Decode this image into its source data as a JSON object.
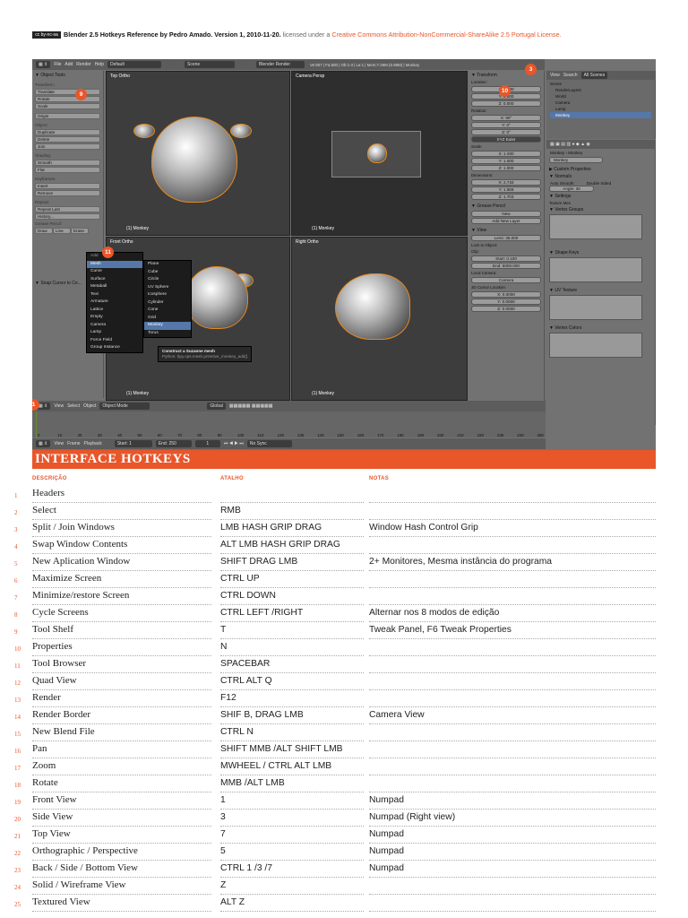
{
  "header": {
    "cc_badge": "cc by-nc-sa",
    "title": "Blender 2.5 Hotkeys Reference by Pedro Amado. Version 1, 2010-11-20.",
    "license_text": " licensed under a ",
    "license_link": "Creative Commons Attribution-NonCommercial-ShareAlike 2.5 Portugal License."
  },
  "screenshot": {
    "top_bar": {
      "menus": [
        "File",
        "Add",
        "Render",
        "Help"
      ],
      "layout": "Default",
      "scene": "Scene",
      "engine": "Blender Render",
      "stats": "Ve:507 | Fa:500 | Ob:1-3 | La:1 | Mem:7.29M (5.98M) | Monkey"
    },
    "tool_shelf": {
      "title": "▼ Object Tools",
      "sections": [
        {
          "label": "Transform:",
          "buttons": [
            "Translate",
            "Rotate",
            "Scale"
          ]
        },
        {
          "label": "",
          "buttons": [
            "Origin"
          ]
        },
        {
          "label": "Object:",
          "buttons": [
            "Duplicate",
            "Delete",
            "Join"
          ]
        },
        {
          "label": "Shading:",
          "buttons": [
            "Smooth",
            "Flat"
          ]
        },
        {
          "label": "Keyframes:",
          "buttons": [
            "Insert",
            "Remove"
          ]
        },
        {
          "label": "Repeat:",
          "buttons": [
            "Repeat Last",
            "History..."
          ]
        },
        {
          "label": "Grease Pencil:",
          "buttons": [
            "Draw",
            "Line",
            "Erase"
          ]
        }
      ],
      "snap_label": "▼ Snap Cursor to Ce..."
    },
    "views": [
      {
        "label": "Top Ortho",
        "footer": "(1) Monkey"
      },
      {
        "label": "Camera Persp",
        "footer": "(1) Monkey"
      },
      {
        "label": "Front Ortho",
        "footer": "(1) Monkey"
      },
      {
        "label": "Right Ortho",
        "footer": "(1) Monkey"
      }
    ],
    "add_menu": {
      "title": "Add",
      "items": [
        "Mesh",
        "Curve",
        "Surface",
        "Metaball",
        "Text",
        "Armature",
        "Lattice",
        "Empty",
        "Camera",
        "Lamp",
        "Force Field",
        "Group Instance"
      ],
      "mesh_items": [
        "Plane",
        "Cube",
        "Circle",
        "UV Sphere",
        "Icosphere",
        "Cylinder",
        "Cone",
        "Grid",
        "Monkey",
        "Torus"
      ],
      "tooltip": "Construct a Suzanne mesh",
      "tooltip_python": "Python: bpy.ops.mesh.primitive_monkey_add()"
    },
    "properties_panel": {
      "transform_title": "▼ Transform",
      "location_label": "Location:",
      "location": [
        "X: 0.000",
        "Y: 0.000",
        "Z: 0.000"
      ],
      "rotation_label": "Rotation:",
      "rotation": [
        "X: 90°",
        "Y: 0°",
        "Z: 0°"
      ],
      "rotation_mode": "XYZ Euler",
      "scale_label": "Scale:",
      "scale": [
        "X: 1.000",
        "Y: 1.000",
        "Z: 1.000"
      ],
      "dimensions_label": "Dimensions:",
      "dimensions": [
        "X: 2.734",
        "Y: 1.969",
        "Z: 1.703"
      ],
      "grease_title": "▼ Grease Pencil",
      "grease_new": "New",
      "grease_add": "Add New Layer",
      "view_title": "▼ View",
      "lens": "Lens: 35.000",
      "lock_label": "Lock to Object:",
      "clip_label": "Clip:",
      "clip": [
        "Start: 0.100",
        "End: 5000.000"
      ],
      "local_camera": "Local Camera:",
      "camera_field": "Camera",
      "cursor_label": "3D Cursor Location:",
      "cursor": [
        "X: 0.0000",
        "Y: 0.0000",
        "Z: 0.0000"
      ]
    },
    "outliner": {
      "header_view": "View",
      "header_search": "Search",
      "header_scope": "All Scenes",
      "items": [
        "Scene",
        "RenderLayers",
        "World",
        "Camera",
        "Lamp",
        "Monkey"
      ]
    },
    "object_props": {
      "breadcrumb": "Monkey",
      "breadcrumb2": "Monkey",
      "name": "Monkey",
      "sections": [
        "▶ Custom Properties",
        "▼ Normals",
        "▼ Settings",
        "▼ Vertex Groups",
        "▼ Shape Keys",
        "▼ UV Texture",
        "▼ Vertex Colors"
      ],
      "auto_smooth": "Auto Smooth",
      "double_sided": "Double Sided",
      "angle": "Angle: 30",
      "texture_mesh": "Texture Mes"
    },
    "view3d_header": {
      "items": [
        "View",
        "Select",
        "Object"
      ],
      "mode": "Object Mode",
      "orientation": "Global"
    },
    "timeline": {
      "ticks": [
        "0",
        "10",
        "20",
        "30",
        "40",
        "50",
        "60",
        "70",
        "80",
        "90",
        "100",
        "110",
        "120",
        "130",
        "140",
        "150",
        "160",
        "170",
        "180",
        "190",
        "200",
        "210",
        "220",
        "230",
        "240",
        "250"
      ],
      "menus": [
        "View",
        "Frame",
        "Playback"
      ],
      "start": "Start: 1",
      "end": "End: 250",
      "current": "1",
      "sync": "No Sync"
    },
    "badges": [
      "1",
      "3",
      "9",
      "10",
      "11"
    ]
  },
  "section_title": "INTERFACE HOTKEYS",
  "columns": {
    "desc": "DESCRIÇÃO",
    "shortcut": "ATALHO",
    "notes": "NOTAS"
  },
  "rows": [
    {
      "n": "1",
      "desc": "Headers",
      "key": "",
      "note": ""
    },
    {
      "n": "2",
      "desc": "Select",
      "key": "RMB",
      "note": ""
    },
    {
      "n": "3",
      "desc": "Split / Join Windows",
      "key": "LMB HASH GRIP DRAG",
      "note": "Window Hash Control Grip"
    },
    {
      "n": "4",
      "desc": "Swap Window Contents",
      "key": "ALT  LMB HASH GRIP DRAG",
      "note": ""
    },
    {
      "n": "5",
      "desc": "New Aplication Window",
      "key": "SHIFT DRAG LMB",
      "note": "2+ Monitores, Mesma instância do programa"
    },
    {
      "n": "6",
      "desc": "Maximize Screen",
      "key": "CTRL UP",
      "note": ""
    },
    {
      "n": "7",
      "desc": "Minimize/restore Screen",
      "key": "CTRL DOWN",
      "note": ""
    },
    {
      "n": "8",
      "desc": "Cycle Screens",
      "key": "CTRL LEFT /RIGHT",
      "note": "Alternar nos 8 modos de edição"
    },
    {
      "n": "9",
      "desc": "Tool Shelf",
      "key": "T",
      "note": "Tweak Panel, F6 Tweak Properties"
    },
    {
      "n": "10",
      "desc": "Properties",
      "key": "N",
      "note": ""
    },
    {
      "n": "11",
      "desc": "Tool Browser",
      "key": "SPACEBAR",
      "note": ""
    },
    {
      "n": "12",
      "desc": "Quad View",
      "key": "CTRL ALT Q",
      "note": ""
    },
    {
      "n": "13",
      "desc": "Render",
      "key": "F12",
      "note": ""
    },
    {
      "n": "14",
      "desc": "Render Border",
      "key": "SHIF B, DRAG LMB",
      "note": "Camera View"
    },
    {
      "n": "15",
      "desc": "New Blend File",
      "key": "CTRL N",
      "note": ""
    },
    {
      "n": "16",
      "desc": "Pan",
      "key": "SHIFT MMB /ALT SHIFT LMB",
      "note": ""
    },
    {
      "n": "17",
      "desc": "Zoom",
      "key": "MWHEEL / CTRL ALT LMB",
      "note": ""
    },
    {
      "n": "18",
      "desc": "Rotate",
      "key": "MMB /ALT LMB",
      "note": ""
    },
    {
      "n": "19",
      "desc": "Front View",
      "key": "1",
      "note": "Numpad"
    },
    {
      "n": "20",
      "desc": "Side View",
      "key": "3",
      "note": "Numpad (Right view)"
    },
    {
      "n": "21",
      "desc": "Top View",
      "key": "7",
      "note": "Numpad"
    },
    {
      "n": "22",
      "desc": "Orthographic / Perspective",
      "key": "5",
      "note": "Numpad"
    },
    {
      "n": "23",
      "desc": "Back / Side / Bottom View",
      "key": "CTRL 1 /3 /7",
      "note": "Numpad"
    },
    {
      "n": "24",
      "desc": "Solid / Wireframe View",
      "key": "Z",
      "note": ""
    },
    {
      "n": "25",
      "desc": "Textured View",
      "key": "ALT Z",
      "note": ""
    }
  ]
}
